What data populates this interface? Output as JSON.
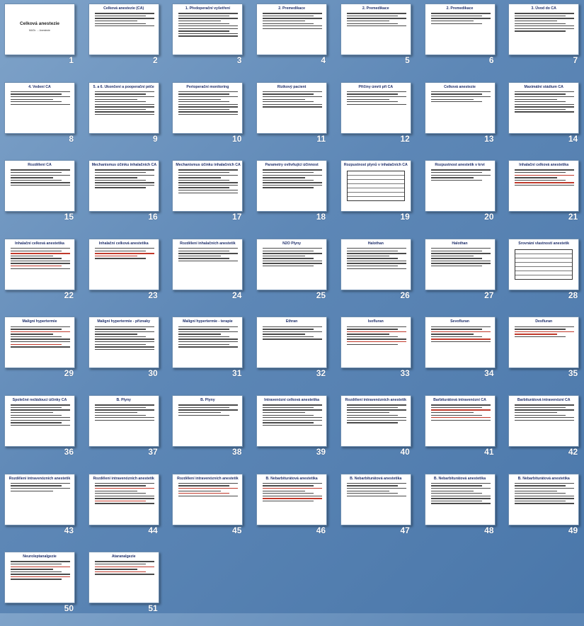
{
  "slides": [
    {
      "n": "1",
      "title": "Celková anestezie",
      "cover": true,
      "sub": "MUDr. ...  Anestezie"
    },
    {
      "n": "2",
      "title": "Celková anestezie (CA)",
      "lines": 6
    },
    {
      "n": "3",
      "title": "1. Předoperační vyšetření",
      "lines": 10
    },
    {
      "n": "4",
      "title": "2. Premedikace",
      "lines": 7
    },
    {
      "n": "5",
      "title": "2. Premedikace",
      "lines": 6
    },
    {
      "n": "6",
      "title": "2. Premedikace",
      "lines": 5
    },
    {
      "n": "7",
      "title": "3. Úvod do CA",
      "lines": 8
    },
    {
      "n": "8",
      "title": "4. Vedení CA",
      "lines": 6
    },
    {
      "n": "9",
      "title": "5. a 6. Ukončení a pooperační péče",
      "lines": 10
    },
    {
      "n": "10",
      "title": "Perioperační monitoring",
      "lines": 10
    },
    {
      "n": "11",
      "title": "Rizikový pacient",
      "lines": 7
    },
    {
      "n": "12",
      "title": "Příčiny úmrtí při CA",
      "lines": 6
    },
    {
      "n": "13",
      "title": "Celková anestezie",
      "lines": 5
    },
    {
      "n": "14",
      "title": "Maximální stádium CA",
      "lines": 9
    },
    {
      "n": "15",
      "title": "Rozdělení CA",
      "lines": 7
    },
    {
      "n": "16",
      "title": "Mechanismus účinku inhalačních CA",
      "lines": 8
    },
    {
      "n": "17",
      "title": "Mechanismus účinku inhalačních CA",
      "lines": 10
    },
    {
      "n": "18",
      "title": "Parametry ovlivňující účinnost",
      "lines": 8
    },
    {
      "n": "19",
      "title": "Rozpustnost plynů v inhalačních CA",
      "table": true
    },
    {
      "n": "20",
      "title": "Rozpustnost anestetik v krvi",
      "lines": 5
    },
    {
      "n": "21",
      "title": "Inhalační celková anestetika",
      "lines": 7,
      "red": true
    },
    {
      "n": "22",
      "title": "Inhalační celková anestetika",
      "lines": 9,
      "red": true
    },
    {
      "n": "23",
      "title": "Inhalační celková anestetika",
      "lines": 5,
      "red": true
    },
    {
      "n": "24",
      "title": "Rozdělení inhalačních anestetik",
      "lines": 6
    },
    {
      "n": "25",
      "title": "N2O Plyny",
      "lines": 8
    },
    {
      "n": "26",
      "title": "Halothan",
      "lines": 9
    },
    {
      "n": "27",
      "title": "Halothan",
      "lines": 8
    },
    {
      "n": "28",
      "title": "Srovnání vlastností anestetik",
      "table": true
    },
    {
      "n": "29",
      "title": "Maligní hypertermie",
      "lines": 9,
      "red": true
    },
    {
      "n": "30",
      "title": "Maligní hypertermie - příznaky",
      "lines": 10
    },
    {
      "n": "31",
      "title": "Maligní hypertermie - terapie",
      "lines": 9
    },
    {
      "n": "32",
      "title": "Ethran",
      "lines": 6
    },
    {
      "n": "33",
      "title": "Isofluran",
      "lines": 8,
      "red": true
    },
    {
      "n": "34",
      "title": "Sevofluran",
      "lines": 7,
      "red": true
    },
    {
      "n": "35",
      "title": "Desfluran",
      "lines": 5,
      "red": true
    },
    {
      "n": "36",
      "title": "Společné nežádoucí účinky CA",
      "lines": 9
    },
    {
      "n": "37",
      "title": "B. Plyny",
      "lines": 7
    },
    {
      "n": "38",
      "title": "B. Plyny",
      "lines": 5
    },
    {
      "n": "39",
      "title": "Intravenózní celková anestetika",
      "lines": 9
    },
    {
      "n": "40",
      "title": "Rozdělení intravenózních anestetik",
      "lines": 8
    },
    {
      "n": "41",
      "title": "Barbiturátová intravenózní CA",
      "lines": 7,
      "red": true
    },
    {
      "n": "42",
      "title": "Barbiturátová intravenózní CA",
      "lines": 7
    },
    {
      "n": "43",
      "title": "Rozdělení intravenózních anestetik",
      "lines": 4
    },
    {
      "n": "44",
      "title": "Rozdělení intravenózních anestetik",
      "lines": 9,
      "red": true
    },
    {
      "n": "45",
      "title": "Rozdělení intravenózních anestetik",
      "lines": 6,
      "red": true
    },
    {
      "n": "46",
      "title": "B. Nebarbiturátová anestetika",
      "lines": 8,
      "red": true
    },
    {
      "n": "47",
      "title": "B. Nebarbiturátová anestetika",
      "lines": 6
    },
    {
      "n": "48",
      "title": "B. Nebarbiturátová anestetika",
      "lines": 9
    },
    {
      "n": "49",
      "title": "B. Nebarbiturátová anestetika",
      "lines": 9
    },
    {
      "n": "50",
      "title": "Neuroleptanalgezie",
      "lines": 8,
      "red": true
    },
    {
      "n": "51",
      "title": "Ataranalgezie",
      "lines": 6,
      "red": true
    }
  ]
}
